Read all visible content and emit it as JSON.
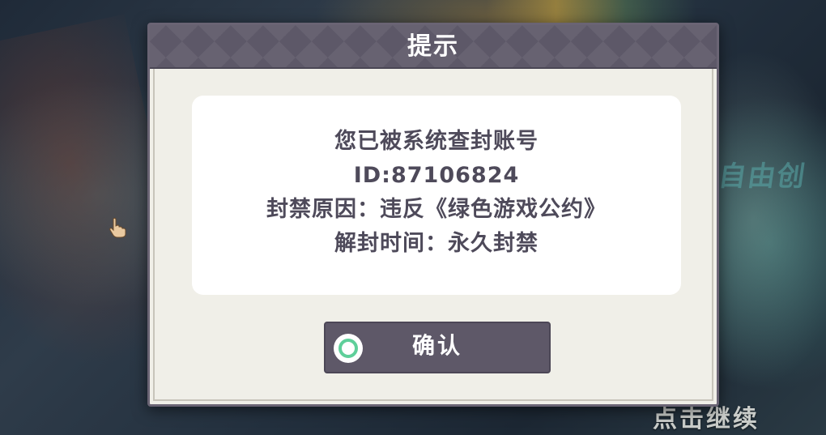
{
  "dialog": {
    "title": "提示",
    "message": {
      "line1": "您已被系统查封账号",
      "line2": "ID:87106824",
      "line3": "封禁原因：违反《绿色游戏公约》",
      "line4": "解封时间：永久封禁"
    },
    "confirm_label": "确认"
  },
  "background": {
    "continue_hint": "点击继续",
    "side_deco_text": "自由创"
  },
  "icons": {
    "pointer": "hand-pointer-icon",
    "confirm": "ring-icon"
  },
  "colors": {
    "header": "#5d5868",
    "button": "#5e5868",
    "ring": "#5fcf9a",
    "text": "#4e4a5a",
    "panel": "#f0efe8"
  }
}
